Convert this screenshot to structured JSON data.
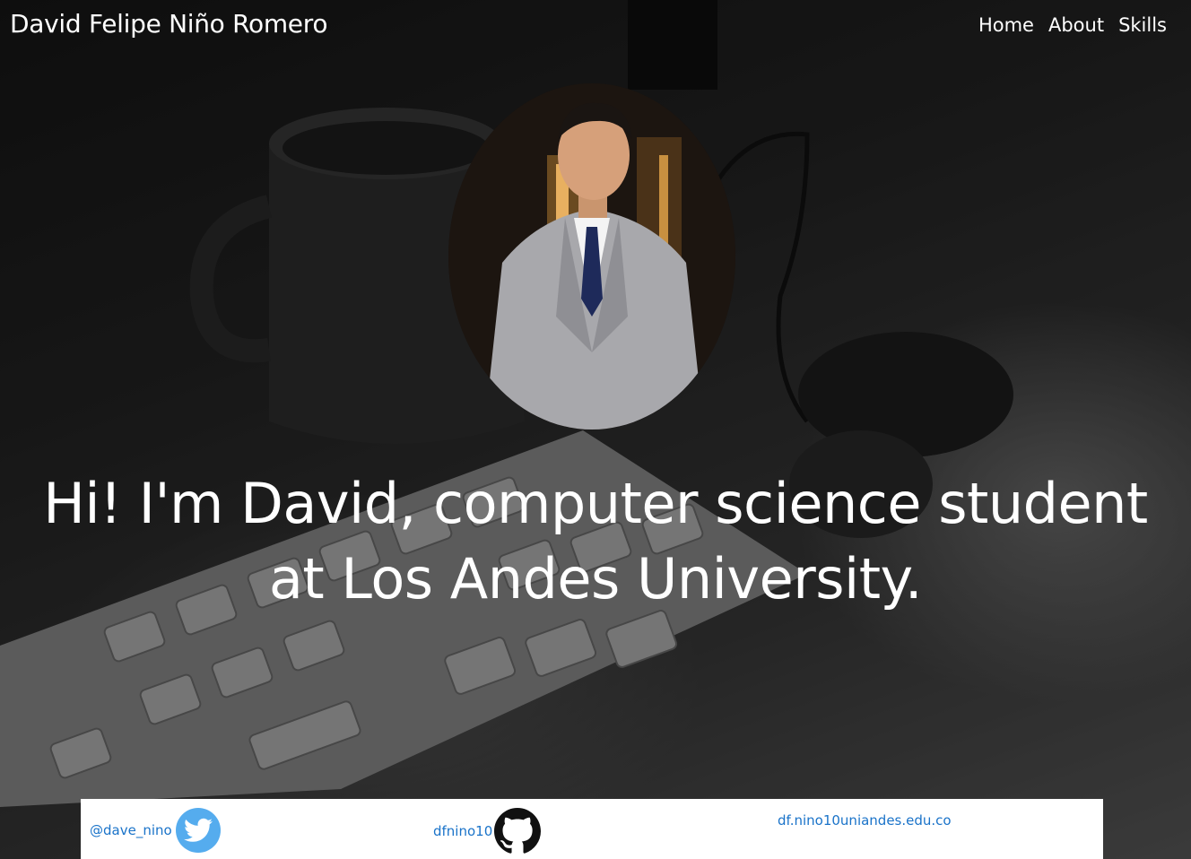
{
  "header": {
    "brand": "David Felipe Niño Romero",
    "nav": [
      {
        "label": "Home"
      },
      {
        "label": "About"
      },
      {
        "label": "Skills"
      }
    ]
  },
  "hero": {
    "line1": "Hi! I'm David, computer science student",
    "line2": "at Los Andes University."
  },
  "footer": {
    "twitter": {
      "handle": "@dave_nino",
      "icon": "twitter-icon"
    },
    "github": {
      "handle": "dfnino10",
      "icon": "github-icon"
    },
    "email": {
      "address": "df.nino10uniandes.edu.co"
    }
  },
  "colors": {
    "link": "#1a73c9",
    "twitter": "#55acee"
  }
}
